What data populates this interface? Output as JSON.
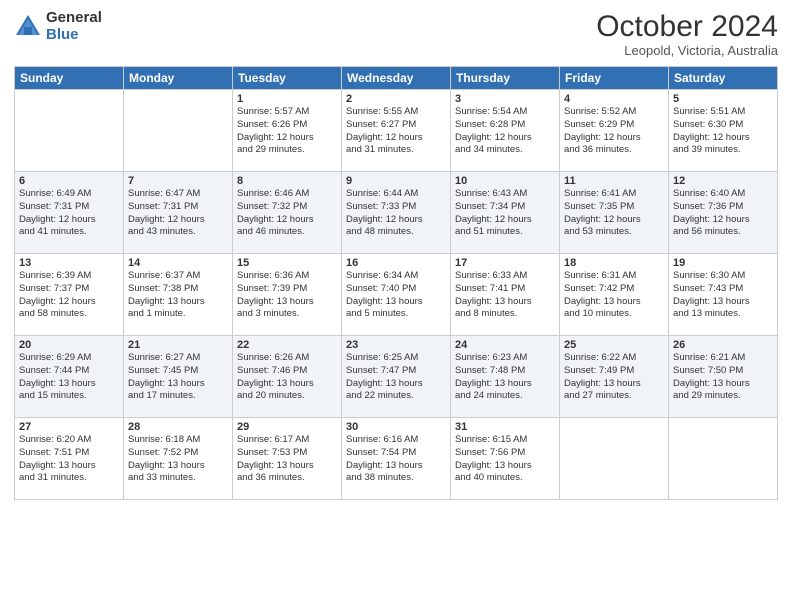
{
  "logo": {
    "general": "General",
    "blue": "Blue"
  },
  "title": "October 2024",
  "location": "Leopold, Victoria, Australia",
  "days_of_week": [
    "Sunday",
    "Monday",
    "Tuesday",
    "Wednesday",
    "Thursday",
    "Friday",
    "Saturday"
  ],
  "weeks": [
    [
      {
        "day": "",
        "info": ""
      },
      {
        "day": "",
        "info": ""
      },
      {
        "day": "1",
        "info": "Sunrise: 5:57 AM\nSunset: 6:26 PM\nDaylight: 12 hours\nand 29 minutes."
      },
      {
        "day": "2",
        "info": "Sunrise: 5:55 AM\nSunset: 6:27 PM\nDaylight: 12 hours\nand 31 minutes."
      },
      {
        "day": "3",
        "info": "Sunrise: 5:54 AM\nSunset: 6:28 PM\nDaylight: 12 hours\nand 34 minutes."
      },
      {
        "day": "4",
        "info": "Sunrise: 5:52 AM\nSunset: 6:29 PM\nDaylight: 12 hours\nand 36 minutes."
      },
      {
        "day": "5",
        "info": "Sunrise: 5:51 AM\nSunset: 6:30 PM\nDaylight: 12 hours\nand 39 minutes."
      }
    ],
    [
      {
        "day": "6",
        "info": "Sunrise: 6:49 AM\nSunset: 7:31 PM\nDaylight: 12 hours\nand 41 minutes."
      },
      {
        "day": "7",
        "info": "Sunrise: 6:47 AM\nSunset: 7:31 PM\nDaylight: 12 hours\nand 43 minutes."
      },
      {
        "day": "8",
        "info": "Sunrise: 6:46 AM\nSunset: 7:32 PM\nDaylight: 12 hours\nand 46 minutes."
      },
      {
        "day": "9",
        "info": "Sunrise: 6:44 AM\nSunset: 7:33 PM\nDaylight: 12 hours\nand 48 minutes."
      },
      {
        "day": "10",
        "info": "Sunrise: 6:43 AM\nSunset: 7:34 PM\nDaylight: 12 hours\nand 51 minutes."
      },
      {
        "day": "11",
        "info": "Sunrise: 6:41 AM\nSunset: 7:35 PM\nDaylight: 12 hours\nand 53 minutes."
      },
      {
        "day": "12",
        "info": "Sunrise: 6:40 AM\nSunset: 7:36 PM\nDaylight: 12 hours\nand 56 minutes."
      }
    ],
    [
      {
        "day": "13",
        "info": "Sunrise: 6:39 AM\nSunset: 7:37 PM\nDaylight: 12 hours\nand 58 minutes."
      },
      {
        "day": "14",
        "info": "Sunrise: 6:37 AM\nSunset: 7:38 PM\nDaylight: 13 hours\nand 1 minute."
      },
      {
        "day": "15",
        "info": "Sunrise: 6:36 AM\nSunset: 7:39 PM\nDaylight: 13 hours\nand 3 minutes."
      },
      {
        "day": "16",
        "info": "Sunrise: 6:34 AM\nSunset: 7:40 PM\nDaylight: 13 hours\nand 5 minutes."
      },
      {
        "day": "17",
        "info": "Sunrise: 6:33 AM\nSunset: 7:41 PM\nDaylight: 13 hours\nand 8 minutes."
      },
      {
        "day": "18",
        "info": "Sunrise: 6:31 AM\nSunset: 7:42 PM\nDaylight: 13 hours\nand 10 minutes."
      },
      {
        "day": "19",
        "info": "Sunrise: 6:30 AM\nSunset: 7:43 PM\nDaylight: 13 hours\nand 13 minutes."
      }
    ],
    [
      {
        "day": "20",
        "info": "Sunrise: 6:29 AM\nSunset: 7:44 PM\nDaylight: 13 hours\nand 15 minutes."
      },
      {
        "day": "21",
        "info": "Sunrise: 6:27 AM\nSunset: 7:45 PM\nDaylight: 13 hours\nand 17 minutes."
      },
      {
        "day": "22",
        "info": "Sunrise: 6:26 AM\nSunset: 7:46 PM\nDaylight: 13 hours\nand 20 minutes."
      },
      {
        "day": "23",
        "info": "Sunrise: 6:25 AM\nSunset: 7:47 PM\nDaylight: 13 hours\nand 22 minutes."
      },
      {
        "day": "24",
        "info": "Sunrise: 6:23 AM\nSunset: 7:48 PM\nDaylight: 13 hours\nand 24 minutes."
      },
      {
        "day": "25",
        "info": "Sunrise: 6:22 AM\nSunset: 7:49 PM\nDaylight: 13 hours\nand 27 minutes."
      },
      {
        "day": "26",
        "info": "Sunrise: 6:21 AM\nSunset: 7:50 PM\nDaylight: 13 hours\nand 29 minutes."
      }
    ],
    [
      {
        "day": "27",
        "info": "Sunrise: 6:20 AM\nSunset: 7:51 PM\nDaylight: 13 hours\nand 31 minutes."
      },
      {
        "day": "28",
        "info": "Sunrise: 6:18 AM\nSunset: 7:52 PM\nDaylight: 13 hours\nand 33 minutes."
      },
      {
        "day": "29",
        "info": "Sunrise: 6:17 AM\nSunset: 7:53 PM\nDaylight: 13 hours\nand 36 minutes."
      },
      {
        "day": "30",
        "info": "Sunrise: 6:16 AM\nSunset: 7:54 PM\nDaylight: 13 hours\nand 38 minutes."
      },
      {
        "day": "31",
        "info": "Sunrise: 6:15 AM\nSunset: 7:56 PM\nDaylight: 13 hours\nand 40 minutes."
      },
      {
        "day": "",
        "info": ""
      },
      {
        "day": "",
        "info": ""
      }
    ]
  ]
}
